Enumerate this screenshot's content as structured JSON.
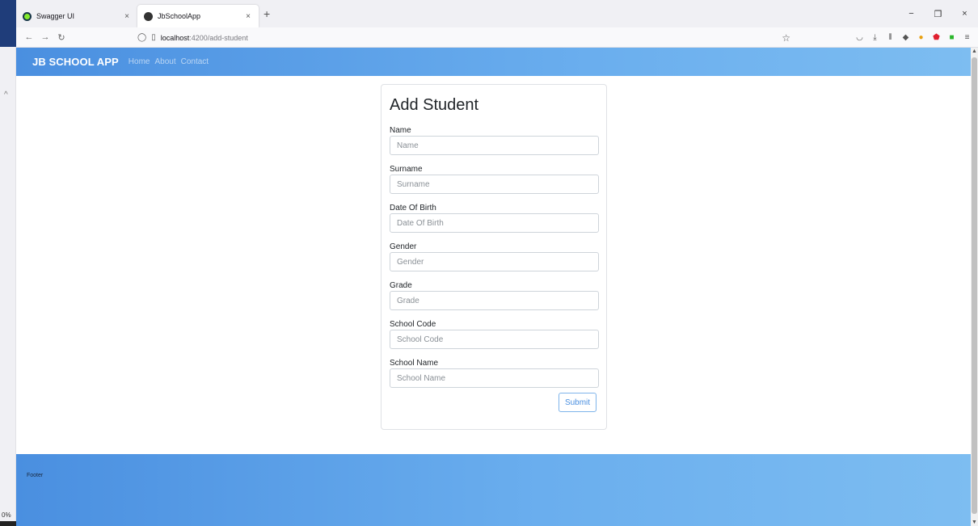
{
  "browser": {
    "tabs": [
      {
        "title": "Swagger UI",
        "close": "×"
      },
      {
        "title": "JbSchoolApp",
        "close": "×"
      }
    ],
    "new_tab": "+",
    "window_controls": {
      "minimize": "−",
      "restore": "❐",
      "close": "×"
    },
    "nav": {
      "back": "←",
      "forward": "→",
      "reload": "↻"
    },
    "url": {
      "host": "localhost",
      "path": ":4200/add-student"
    },
    "zoom_text": "0%"
  },
  "app": {
    "brand": "JB SCHOOL APP",
    "nav_links": [
      "Home",
      "About",
      "Contact"
    ],
    "footer_text": "Footer",
    "colors": {
      "header_gradient_start": "#4a8fe0",
      "header_gradient_end": "#7dbdf1",
      "button_accent": "#4a8fe0"
    }
  },
  "form": {
    "title": "Add Student",
    "fields": [
      {
        "label": "Name",
        "placeholder": "Name",
        "value": ""
      },
      {
        "label": "Surname",
        "placeholder": "Surname",
        "value": ""
      },
      {
        "label": "Date Of Birth",
        "placeholder": "Date Of Birth",
        "value": ""
      },
      {
        "label": "Gender",
        "placeholder": "Gender",
        "value": ""
      },
      {
        "label": "Grade",
        "placeholder": "Grade",
        "value": ""
      },
      {
        "label": "School Code",
        "placeholder": "School Code",
        "value": ""
      },
      {
        "label": "School Name",
        "placeholder": "School Name",
        "value": ""
      }
    ],
    "submit_label": "Submit"
  }
}
